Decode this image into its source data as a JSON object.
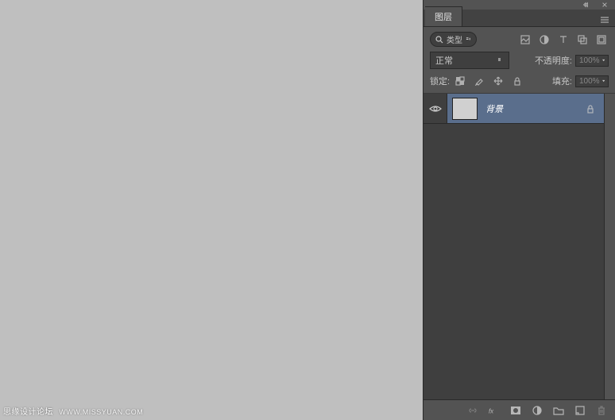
{
  "panel": {
    "tab_label": "图层",
    "filter_label": "类型",
    "blend_mode": "正常",
    "opacity_label": "不透明度:",
    "opacity_value": "100%",
    "lock_label": "锁定:",
    "fill_label": "填充:",
    "fill_value": "100%"
  },
  "layers": [
    {
      "name": "背景",
      "visible": true,
      "locked": true
    }
  ],
  "watermark": {
    "text": "思缘设计论坛",
    "site": "WWW.MISSYUAN.COM"
  }
}
